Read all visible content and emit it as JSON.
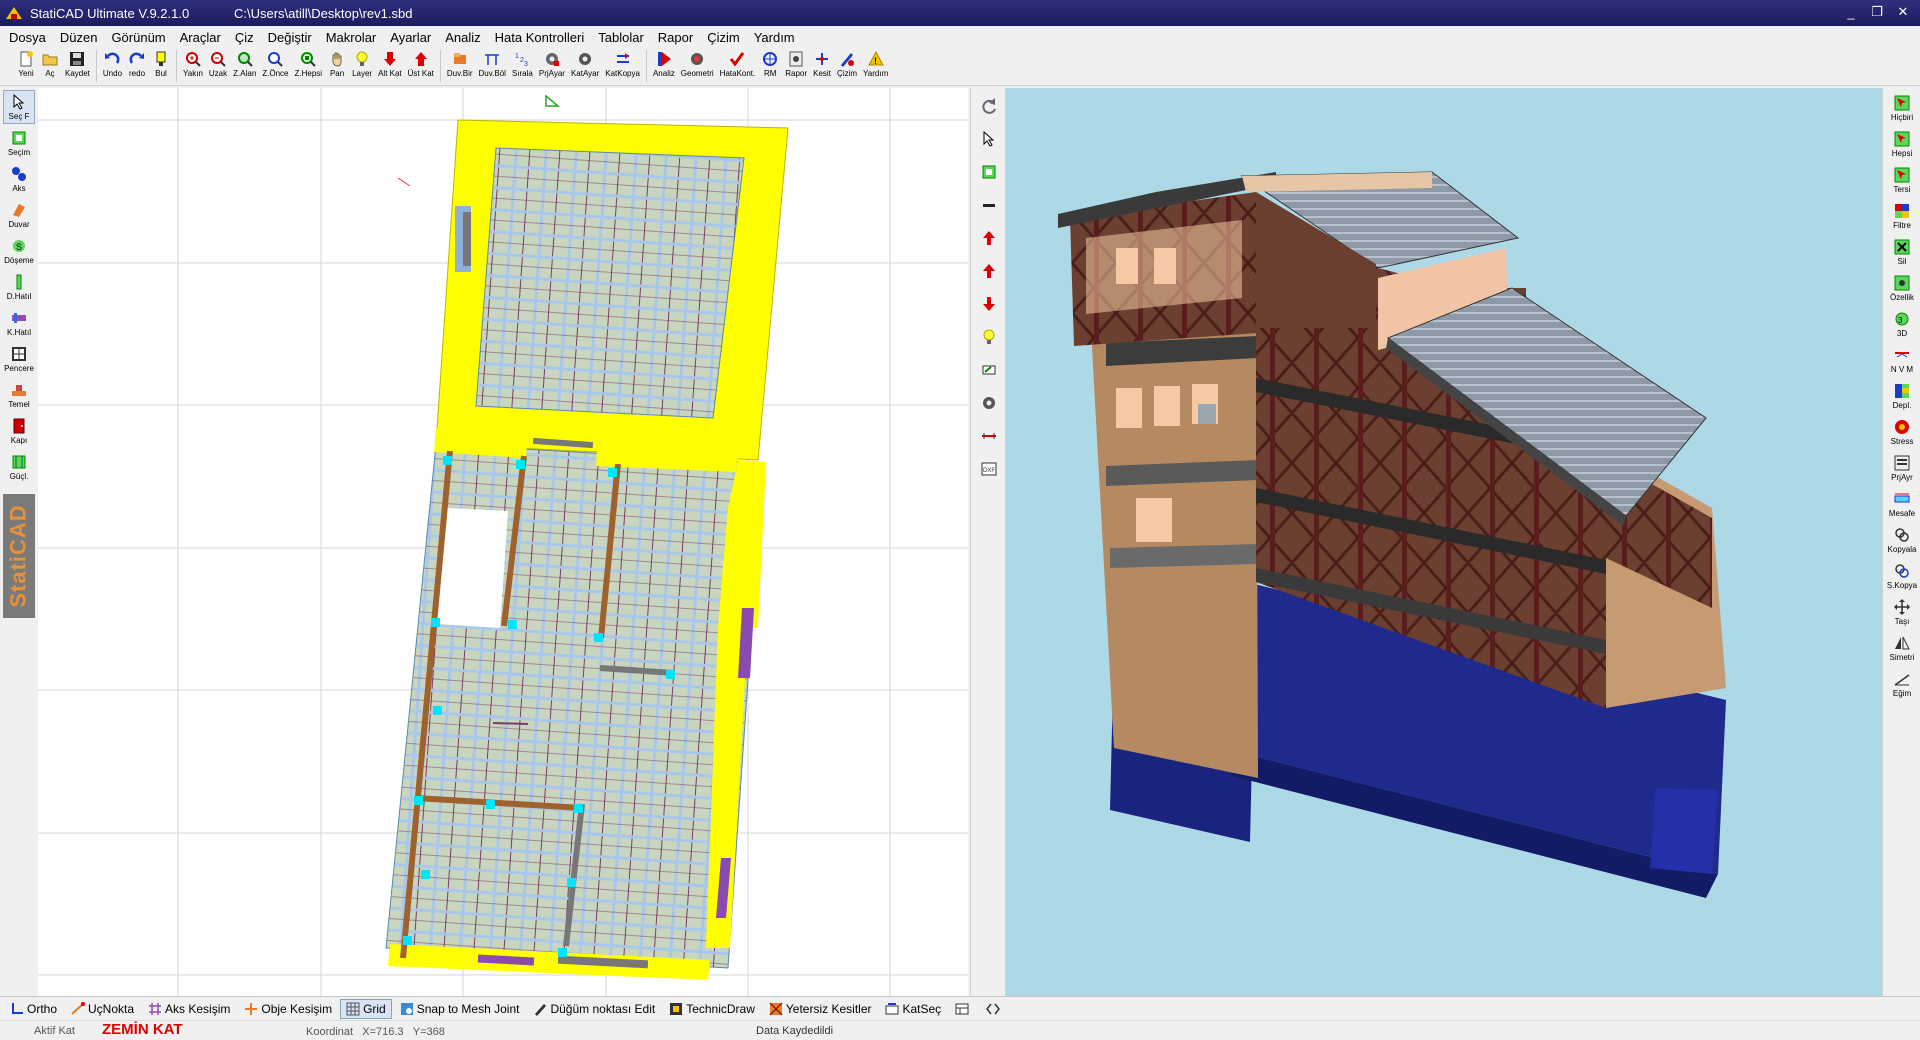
{
  "window": {
    "app_title": "StatiCAD Ultimate V.9.2.1.0",
    "file_path": "C:\\Users\\atill\\Desktop\\rev1.sbd"
  },
  "menu": [
    "Dosya",
    "Düzen",
    "Görünüm",
    "Araçlar",
    "Çiz",
    "Değiştir",
    "Makrolar",
    "Ayarlar",
    "Analiz",
    "Hata Kontrolleri",
    "Tablolar",
    "Rapor",
    "Çizim",
    "Yardım"
  ],
  "toolbar": [
    {
      "label": "Yeni",
      "icon": "new-file-icon"
    },
    {
      "label": "Aç",
      "icon": "open-folder-icon"
    },
    {
      "label": "Kaydet",
      "icon": "save-disk-icon"
    },
    {
      "label": "Undo",
      "icon": "undo-icon"
    },
    {
      "label": "redo",
      "icon": "redo-icon"
    },
    {
      "label": "Bul",
      "icon": "find-icon"
    },
    {
      "label": "Yakın",
      "icon": "zoom-in-icon"
    },
    {
      "label": "Uzak",
      "icon": "zoom-out-icon"
    },
    {
      "label": "Z.Alan",
      "icon": "zoom-area-icon"
    },
    {
      "label": "Z.Önce",
      "icon": "zoom-previous-icon"
    },
    {
      "label": "Z.Hepsi",
      "icon": "zoom-all-icon"
    },
    {
      "label": "Pan",
      "icon": "pan-hand-icon"
    },
    {
      "label": "Layer",
      "icon": "layer-bulb-icon"
    },
    {
      "label": "Alt Kat",
      "icon": "lower-floor-icon"
    },
    {
      "label": "Üst Kat",
      "icon": "upper-floor-icon"
    },
    {
      "label": "Duv.Bir",
      "icon": "wall-join-icon"
    },
    {
      "label": "Duv.Böl",
      "icon": "wall-split-icon"
    },
    {
      "label": "Sırala",
      "icon": "sort-icon"
    },
    {
      "label": "PrjAyar",
      "icon": "project-settings-icon"
    },
    {
      "label": "KatAyar",
      "icon": "floor-settings-icon"
    },
    {
      "label": "KatKopya",
      "icon": "floor-copy-icon"
    },
    {
      "label": "Analiz",
      "icon": "analysis-icon"
    },
    {
      "label": "Geometri",
      "icon": "geometry-icon"
    },
    {
      "label": "HataKont.",
      "icon": "error-check-icon"
    },
    {
      "label": "RM",
      "icon": "rm-icon"
    },
    {
      "label": "Rapor",
      "icon": "report-icon"
    },
    {
      "label": "Kesit",
      "icon": "section-icon"
    },
    {
      "label": "Çizim",
      "icon": "drawing-icon"
    },
    {
      "label": "Yardım",
      "icon": "help-icon"
    }
  ],
  "left_tools": [
    {
      "label": "Seç F",
      "icon": "select-cursor-icon",
      "active": true
    },
    {
      "label": "Seçim",
      "icon": "selection-box-icon"
    },
    {
      "label": "Aks",
      "icon": "axis-icon"
    },
    {
      "label": "Duvar",
      "icon": "wall-icon"
    },
    {
      "label": "Döşeme",
      "icon": "slab-icon"
    },
    {
      "label": "D.Hatıl",
      "icon": "vertical-beam-icon"
    },
    {
      "label": "K.Hatıl",
      "icon": "horizontal-beam-icon"
    },
    {
      "label": "Pencere",
      "icon": "window-icon"
    },
    {
      "label": "Temel",
      "icon": "foundation-icon"
    },
    {
      "label": "Kapı",
      "icon": "door-icon"
    },
    {
      "label": "Güçl.",
      "icon": "reinforcement-icon"
    }
  ],
  "brand_vertical": "StatiCAD",
  "mid_tools": [
    "rotate-icon",
    "pointer-icon",
    "select-box-icon",
    "minus-icon",
    "up-arrow-icon",
    "up-red-arrow-icon",
    "down-red-arrow-icon",
    "bulb-icon",
    "paint-icon",
    "gear-icon",
    "measure-icon",
    "dxf-icon"
  ],
  "right_tools": [
    {
      "label": "Hiçbiri",
      "icon": "select-none-icon"
    },
    {
      "label": "Hepsi",
      "icon": "select-all-icon"
    },
    {
      "label": "Tersi",
      "icon": "invert-selection-icon"
    },
    {
      "label": "Filtre",
      "icon": "filter-icon"
    },
    {
      "label": "Sil",
      "icon": "delete-icon"
    },
    {
      "label": "Özellik",
      "icon": "properties-icon"
    },
    {
      "label": "3D",
      "icon": "view-3d-icon"
    },
    {
      "label": "N V M",
      "icon": "nvm-icon"
    },
    {
      "label": "Depl.",
      "icon": "displacement-icon"
    },
    {
      "label": "Stress",
      "icon": "stress-icon"
    },
    {
      "label": "PrjAyr",
      "icon": "project-settings-icon"
    },
    {
      "label": "Mesafe",
      "icon": "distance-icon"
    },
    {
      "label": "Kopyala",
      "icon": "copy-icon"
    },
    {
      "label": "S.Kopya",
      "icon": "special-copy-icon"
    },
    {
      "label": "Taşı",
      "icon": "move-icon"
    },
    {
      "label": "Simetri",
      "icon": "mirror-icon"
    },
    {
      "label": "Eğim",
      "icon": "slope-icon"
    }
  ],
  "bottom_toggles": [
    {
      "label": "Ortho",
      "icon": "ortho-icon",
      "on": false
    },
    {
      "label": "UçNokta",
      "icon": "endpoint-icon",
      "on": false
    },
    {
      "label": "Aks Kesişim",
      "icon": "axis-intersection-icon",
      "on": false
    },
    {
      "label": "Obje Kesişim",
      "icon": "object-intersection-icon",
      "on": false
    },
    {
      "label": "Grid",
      "icon": "grid-icon",
      "on": true
    },
    {
      "label": "Snap to Mesh Joint",
      "icon": "snap-mesh-icon",
      "on": false
    },
    {
      "label": "Düğüm noktası Edit",
      "icon": "node-edit-icon",
      "on": false
    },
    {
      "label": "TechnicDraw",
      "icon": "technic-draw-icon",
      "on": false
    },
    {
      "label": "Yetersiz Kesitler",
      "icon": "insufficient-sections-icon",
      "on": false
    },
    {
      "label": "KatSeç",
      "icon": "floor-select-icon",
      "on": false
    },
    {
      "label": "",
      "icon": "layout-icon",
      "on": false
    },
    {
      "label": "",
      "icon": "code-arrows-icon",
      "on": false
    }
  ],
  "status": {
    "aktif_label": "Aktif Kat",
    "kat_name": "ZEMİN KAT",
    "koordinat_label": "Koordinat",
    "x": "X=716.3",
    "y": "Y=368",
    "saved": "Data Kaydedildi"
  },
  "colors": {
    "titlebar": "#1c1c5c",
    "wall_yellow": "#ffff00",
    "slab_fill": "#c8d8b8",
    "timber_brown": "#a0622d",
    "column_cyan": "#00e5ff",
    "sky_3d": "#add8e6",
    "foundation_blue": "#1a237e",
    "kat_red": "#e00000"
  }
}
